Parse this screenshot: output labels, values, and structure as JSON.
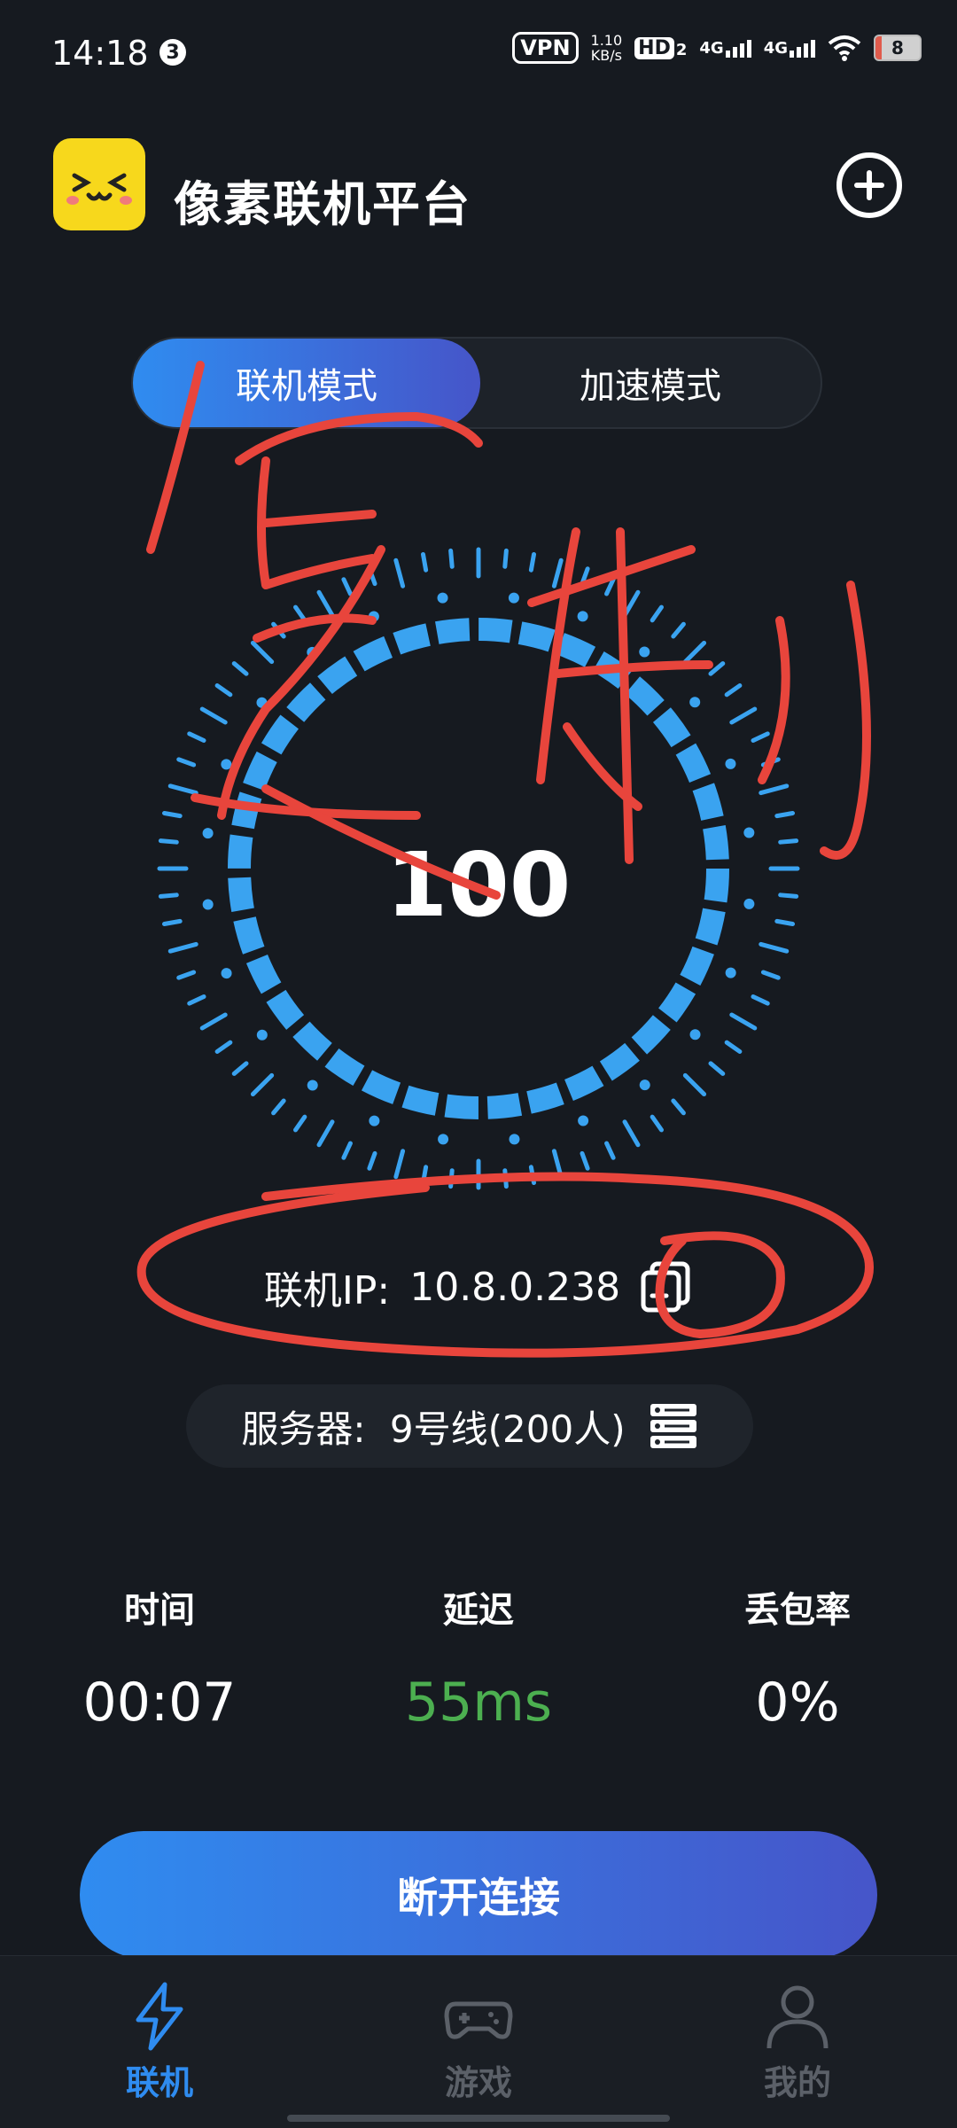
{
  "status_bar": {
    "time": "14:18",
    "notification_count": "3",
    "vpn": "VPN",
    "net_speed_value": "1.10",
    "net_speed_unit": "KB/s",
    "hd": "HD",
    "hd_sub": "2",
    "signal1": "4G",
    "signal2": "4G",
    "battery": "8"
  },
  "header": {
    "title": "像素联机平台",
    "logo_icon": "cat-face-icon",
    "add_icon": "plus-circle-icon"
  },
  "mode_switch": {
    "tabs": [
      {
        "label": "联机模式",
        "active": true
      },
      {
        "label": "加速模式",
        "active": false
      }
    ]
  },
  "gauge": {
    "value": "100",
    "percent": 100
  },
  "connection": {
    "ip_label": "联机IP:",
    "ip_value": "10.8.0.238",
    "server_label": "服务器:",
    "server_value": "9号线(200人)"
  },
  "stats": [
    {
      "label": "时间",
      "value": "00:07"
    },
    {
      "label": "延迟",
      "value": "55ms"
    },
    {
      "label": "丢包率",
      "value": "0%"
    }
  ],
  "actions": {
    "disconnect_label": "断开连接"
  },
  "bottom_nav": {
    "items": [
      {
        "label": "联机",
        "icon": "lightning-icon",
        "active": true
      },
      {
        "label": "游戏",
        "icon": "gamepad-icon",
        "active": false
      },
      {
        "label": "我的",
        "icon": "user-icon",
        "active": false
      }
    ]
  },
  "colors": {
    "background": "#161a20",
    "accent": "#2f8cf0",
    "accent2": "#4655c9",
    "gauge": "#3aa3f0",
    "latency_good": "#4caf50",
    "annotation": "#e8453c",
    "inactive": "#5b6068"
  },
  "annotation": {
    "text": "复制"
  }
}
